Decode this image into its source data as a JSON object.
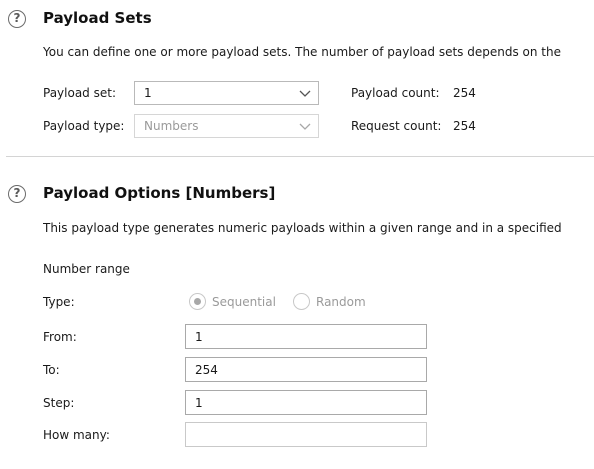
{
  "payload_sets": {
    "title": "Payload Sets",
    "description": "You can define one or more payload sets. The number of payload sets depends on the",
    "payload_set_label": "Payload set:",
    "payload_set_value": "1",
    "payload_type_label": "Payload type:",
    "payload_type_value": "Numbers",
    "payload_count_label": "Payload count:",
    "payload_count_value": "254",
    "request_count_label": "Request count:",
    "request_count_value": "254"
  },
  "payload_options": {
    "title": "Payload Options [Numbers]",
    "description": "This payload type generates numeric payloads within a given range and in a specified",
    "number_range_label": "Number range",
    "type_label": "Type:",
    "type_options": [
      "Sequential",
      "Random"
    ],
    "type_selected": "Sequential",
    "from_label": "From:",
    "from_value": "1",
    "to_label": "To:",
    "to_value": "254",
    "step_label": "Step:",
    "step_value": "1",
    "how_many_label": "How many:",
    "how_many_value": ""
  },
  "icons": {
    "help": "help-circle-icon",
    "dropdown": "chevron-down-icon"
  },
  "colors": {
    "text": "#1a1a1a",
    "disabled_text": "#9a9a9a",
    "border": "#b9b9b9",
    "divider": "#d4d4d4"
  }
}
